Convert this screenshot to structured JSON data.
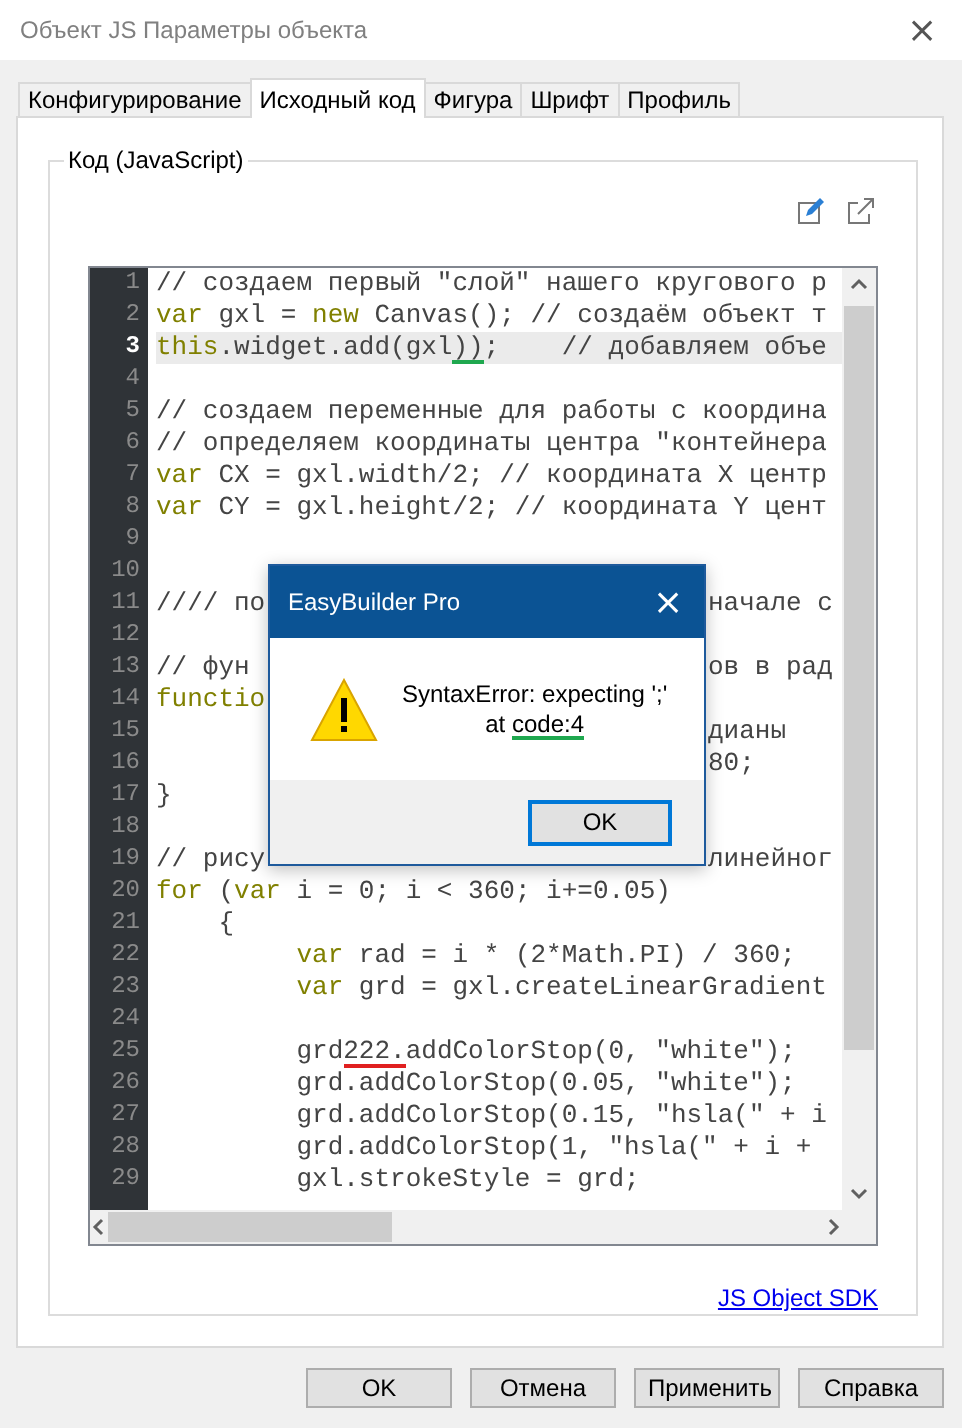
{
  "window": {
    "title": "Объект JS Параметры объекта",
    "close": "×"
  },
  "tabs": [
    {
      "label": "Конфигурирование",
      "selected": false
    },
    {
      "label": "Исходный код",
      "selected": true
    },
    {
      "label": "Фигура",
      "selected": false
    },
    {
      "label": "Шрифт",
      "selected": false
    },
    {
      "label": "Профиль",
      "selected": false
    }
  ],
  "group": {
    "title": "Код (JavaScript)"
  },
  "editor": {
    "lines": [
      {
        "num": "1",
        "current": false,
        "segments": [
          {
            "kind": "plain",
            "text": "// создаем первый \"слой\" нашего кругового р"
          }
        ]
      },
      {
        "num": "2",
        "current": false,
        "segments": [
          {
            "kind": "keyword",
            "text": "var"
          },
          {
            "kind": "plain",
            "text": " gxl = "
          },
          {
            "kind": "keyword",
            "text": "new"
          },
          {
            "kind": "plain",
            "text": " Canvas(); // создаём объект т"
          }
        ]
      },
      {
        "num": "3",
        "current": true,
        "segments": [
          {
            "kind": "keyword",
            "text": "this"
          },
          {
            "kind": "plain",
            "text": ".widget.add(gxl"
          },
          {
            "kind": "plain",
            "text": "))",
            "underline": {
              "color": "#1fa84f"
            }
          },
          {
            "kind": "plain",
            "text": ";    // добавляем объе"
          }
        ]
      },
      {
        "num": "4",
        "current": false
      },
      {
        "num": "5",
        "current": false,
        "segments": [
          {
            "kind": "plain",
            "text": "// создаем переменные для работы с координа"
          }
        ]
      },
      {
        "num": "6",
        "current": false,
        "segments": [
          {
            "kind": "plain",
            "text": "// определяем координаты центра \"контейнера"
          }
        ]
      },
      {
        "num": "7",
        "current": false,
        "segments": [
          {
            "kind": "keyword",
            "text": "var"
          },
          {
            "kind": "plain",
            "text": " CX = gxl.width/2; // координата X центр"
          }
        ]
      },
      {
        "num": "8",
        "current": false,
        "segments": [
          {
            "kind": "keyword",
            "text": "var"
          },
          {
            "kind": "plain",
            "text": " CY = gxl.height/2; // координата Y цент"
          }
        ]
      },
      {
        "num": "9",
        "current": false
      },
      {
        "num": "10",
        "current": false
      },
      {
        "num": "11",
        "current": false,
        "segments": [
          {
            "kind": "plain",
            "text": "//// по"
          }
        ],
        "after_dialog": "начале с"
      },
      {
        "num": "12",
        "current": false
      },
      {
        "num": "13",
        "current": false,
        "segments": [
          {
            "kind": "plain",
            "text": "// фун"
          }
        ],
        "after_dialog": "ов в рад"
      },
      {
        "num": "14",
        "current": false,
        "segments": [
          {
            "kind": "keyword",
            "text": "functio"
          }
        ]
      },
      {
        "num": "15",
        "current": false,
        "after_dialog": "дианы"
      },
      {
        "num": "16",
        "current": false,
        "after_dialog": "80;"
      },
      {
        "num": "17",
        "current": false,
        "segments": [
          {
            "kind": "plain",
            "text": "}"
          }
        ]
      },
      {
        "num": "18",
        "current": false
      },
      {
        "num": "19",
        "current": false,
        "segments": [
          {
            "kind": "plain",
            "text": "// рису"
          }
        ],
        "after_dialog": "линейног"
      },
      {
        "num": "20",
        "current": false,
        "segments": [
          {
            "kind": "keyword",
            "text": "for"
          },
          {
            "kind": "plain",
            "text": " ("
          },
          {
            "kind": "keyword",
            "text": "var"
          },
          {
            "kind": "plain",
            "text": " i = 0; i < 360; i+=0.05)"
          }
        ]
      },
      {
        "num": "21",
        "current": false,
        "segments": [
          {
            "kind": "plain",
            "text": "    {"
          }
        ]
      },
      {
        "num": "22",
        "current": false,
        "segments": [
          {
            "kind": "keyword",
            "text": "         var"
          },
          {
            "kind": "plain",
            "text": " rad = i * (2*Math.PI) / 360;"
          }
        ]
      },
      {
        "num": "23",
        "current": false,
        "segments": [
          {
            "kind": "keyword",
            "text": "         var"
          },
          {
            "kind": "plain",
            "text": " grd = gxl.createLinearGradient"
          }
        ]
      },
      {
        "num": "24",
        "current": false
      },
      {
        "num": "25",
        "current": false,
        "segments": [
          {
            "kind": "plain",
            "text": "         grd"
          },
          {
            "kind": "plain",
            "text": "222.",
            "underline": {
              "color": "#e02020"
            }
          },
          {
            "kind": "plain",
            "text": "addColorStop(0, \"white\");"
          }
        ]
      },
      {
        "num": "26",
        "current": false,
        "segments": [
          {
            "kind": "plain",
            "text": "         grd.addColorStop(0.05, \"white\");"
          }
        ]
      },
      {
        "num": "27",
        "current": false,
        "segments": [
          {
            "kind": "plain",
            "text": "         grd.addColorStop(0.15, \"hsla(\" + i"
          }
        ]
      },
      {
        "num": "28",
        "current": false,
        "segments": [
          {
            "kind": "plain",
            "text": "         grd.addColorStop(1, \"hsla(\" + i +"
          }
        ]
      },
      {
        "num": "29",
        "current": false,
        "segments": [
          {
            "kind": "plain",
            "text": "         gxl.strokeStyle = grd;"
          }
        ]
      }
    ]
  },
  "link": "JS Object SDK",
  "dialog": {
    "title": "EasyBuilder Pro",
    "close": "×",
    "message": [
      {
        "segments": [
          {
            "text": "SyntaxError: expecting ';'"
          }
        ]
      },
      {
        "segments": [
          {
            "text": "at "
          },
          {
            "text": "code:4",
            "underline": {
              "color": "#1fa84f"
            }
          }
        ]
      }
    ],
    "button": "OK"
  },
  "buttons": [
    "OK",
    "Отмена",
    "Применить",
    "Справка"
  ]
}
